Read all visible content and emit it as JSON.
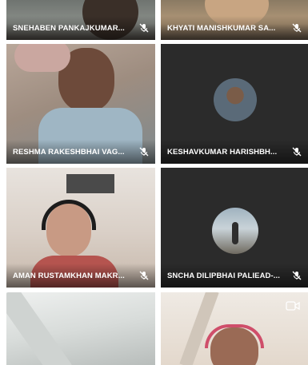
{
  "participants": [
    {
      "name": "SNEHABEN PANKAJKUMAR...",
      "mic": "mic-muted-icon"
    },
    {
      "name": "KHYATI MANISHKUMAR SA...",
      "mic": "mic-muted-icon"
    },
    {
      "name": "RESHMA RAKESHBHAI VAG...",
      "mic": "mic-muted-icon"
    },
    {
      "name": "KESHAVKUMAR HARISHBH...",
      "mic": "mic-muted-icon"
    },
    {
      "name": "AMAN RUSTAMKHAN MAKR...",
      "mic": "mic-muted-icon"
    },
    {
      "name": "SNCHA DILIPBHAI PALIEAD-...",
      "mic": "mic-muted-icon"
    }
  ],
  "colors": {
    "tile_dark": "#2b2b2b",
    "label_text": "#ffffff"
  },
  "icons": {
    "camera_off": "camera-off-icon"
  }
}
